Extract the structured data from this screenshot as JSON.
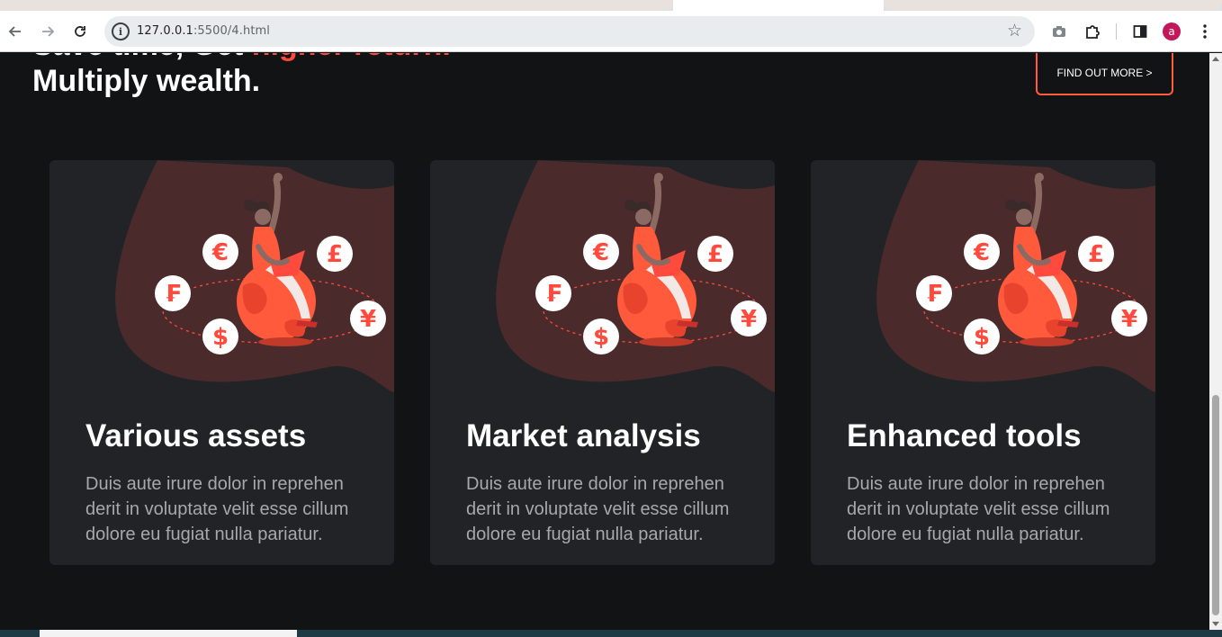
{
  "browser": {
    "url_host": "127.0.0.1",
    "url_rest": ":5500/4.html",
    "avatar_initial": "a"
  },
  "hero": {
    "line1_prefix": "Save time, Get ",
    "line1_accent": "higher return.",
    "line2": "Multiply wealth.",
    "cta_label": "FIND OUT MORE >"
  },
  "cards": [
    {
      "title": "Various assets",
      "text": "Duis aute irure dolor in reprehen derit in voluptate velit esse cillum dolore eu fugiat nulla pariatur."
    },
    {
      "title": "Market analysis",
      "text": "Duis aute irure dolor in reprehen derit in voluptate velit esse cillum dolore eu fugiat nulla pariatur."
    },
    {
      "title": "Enhanced tools",
      "text": "Duis aute irure dolor in reprehen derit in voluptate velit esse cillum dolore eu fugiat nulla pariatur."
    }
  ],
  "illustration": {
    "currency_symbols": [
      "€",
      "£",
      "₣",
      "$",
      "¥"
    ]
  },
  "colors": {
    "accent": "#ff4a3d",
    "page_bg": "#111315",
    "card_bg": "#212326",
    "blob": "#4a2a2a"
  }
}
